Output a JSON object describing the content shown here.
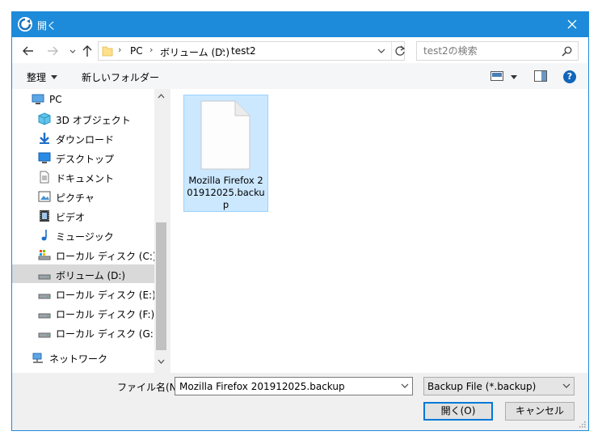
{
  "window": {
    "title": "開く"
  },
  "address": {
    "crumbs": [
      "PC",
      "ボリューム (D:)",
      "test2"
    ]
  },
  "search": {
    "placeholder": "test2の検索"
  },
  "toolbar": {
    "organize_label": "整理",
    "new_folder_label": "新しいフォルダー",
    "help_label": "?"
  },
  "nav": {
    "items": [
      {
        "label": "PC",
        "icon": "pc-icon"
      },
      {
        "label": "3D オブジェクト",
        "icon": "3d-objects-icon"
      },
      {
        "label": "ダウンロード",
        "icon": "download-icon"
      },
      {
        "label": "デスクトップ",
        "icon": "desktop-icon"
      },
      {
        "label": "ドキュメント",
        "icon": "document-icon"
      },
      {
        "label": "ピクチャ",
        "icon": "pictures-icon"
      },
      {
        "label": "ビデオ",
        "icon": "video-icon"
      },
      {
        "label": "ミュージック",
        "icon": "music-icon"
      },
      {
        "label": "ローカル ディスク (C:)",
        "icon": "system-drive-icon"
      },
      {
        "label": "ボリューム (D:)",
        "icon": "drive-icon",
        "selected": true
      },
      {
        "label": "ローカル ディスク (E:)",
        "icon": "drive-icon"
      },
      {
        "label": "ローカル ディスク (F:)",
        "icon": "drive-icon"
      },
      {
        "label": "ローカル ディスク (G:)",
        "icon": "drive-icon"
      },
      {
        "label": "ネットワーク",
        "icon": "network-icon"
      }
    ]
  },
  "files": [
    {
      "name": "Mozilla Firefox 201912025.backup",
      "icon": "file-icon",
      "selected": true
    }
  ],
  "bottom": {
    "filename_label": "ファイル名(N):",
    "filename_value": "Mozilla Firefox 201912025.backup",
    "filetype_value": "Backup File (*.backup)",
    "open_label": "開く(O)",
    "cancel_label": "キャンセル"
  },
  "colors": {
    "titlebar": "#1d8bd9",
    "selection": "#cce8ff",
    "help": "#1265b8"
  }
}
